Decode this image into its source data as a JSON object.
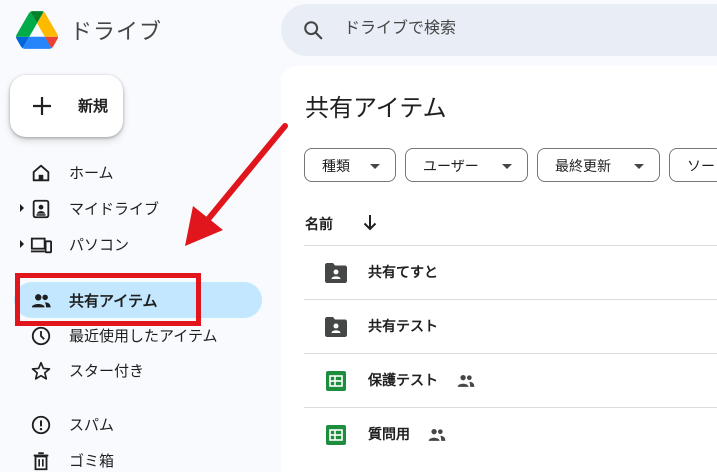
{
  "header": {
    "app_title": "ドライブ",
    "search": {
      "placeholder": "ドライブで検索"
    }
  },
  "sidebar": {
    "new_button_label": "新規",
    "items": [
      {
        "label": "ホーム",
        "icon": "home-icon",
        "expandable": false,
        "active": false
      },
      {
        "label": "マイドライブ",
        "icon": "my-drive-icon",
        "expandable": true,
        "active": false
      },
      {
        "label": "パソコン",
        "icon": "computers-icon",
        "expandable": true,
        "active": false
      },
      {
        "label": "共有アイテム",
        "icon": "shared-people-icon",
        "expandable": false,
        "active": true
      },
      {
        "label": "最近使用したアイテム",
        "icon": "clock-icon",
        "expandable": false,
        "active": false
      },
      {
        "label": "スター付き",
        "icon": "star-icon",
        "expandable": false,
        "active": false
      },
      {
        "label": "スパム",
        "icon": "spam-icon",
        "expandable": false,
        "active": false
      },
      {
        "label": "ゴミ箱",
        "icon": "trash-icon",
        "expandable": false,
        "active": false
      }
    ]
  },
  "main": {
    "title": "共有アイテム",
    "filters": [
      {
        "label": "種類"
      },
      {
        "label": "ユーザー"
      },
      {
        "label": "最終更新"
      },
      {
        "label": "ソー"
      }
    ],
    "column_header": "名前",
    "sort_icon": "arrow-down-icon",
    "files": [
      {
        "name": "共有てすと",
        "type": "shared-folder",
        "shared": false
      },
      {
        "name": "共有テスト",
        "type": "shared-folder",
        "shared": false
      },
      {
        "name": "保護テスト",
        "type": "sheets",
        "shared": true
      },
      {
        "name": "質問用",
        "type": "sheets",
        "shared": true
      }
    ]
  },
  "colors": {
    "active_nav_bg": "#c2e7ff",
    "search_bg": "#e9eef6",
    "page_bg": "#f8fafd",
    "sheets_green": "#1e8e3e",
    "annotation_red": "#e0161c"
  }
}
